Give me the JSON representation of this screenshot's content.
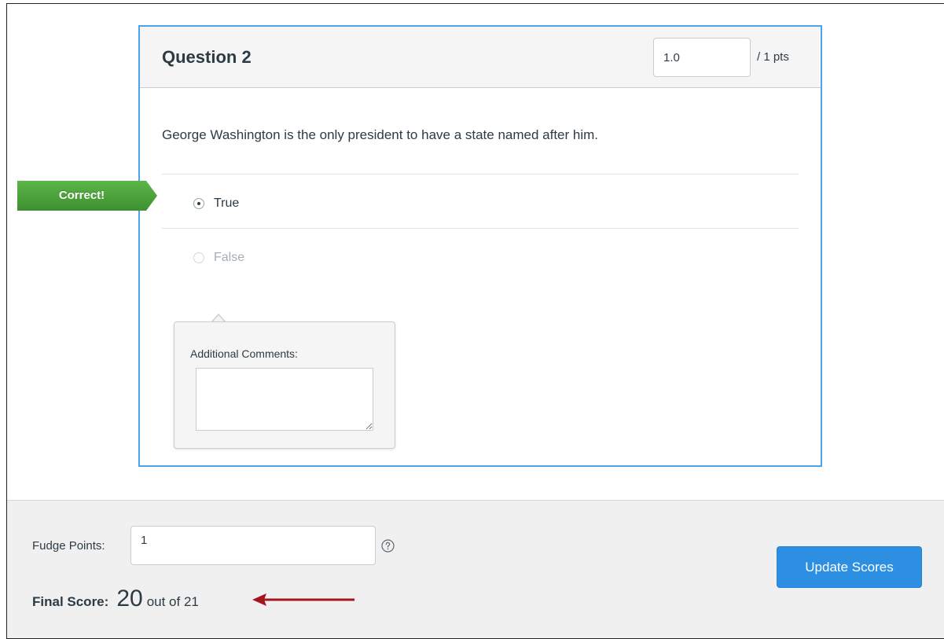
{
  "question": {
    "title": "Question 2",
    "points_value": "1.0",
    "points_suffix": "/ 1 pts",
    "text": "George Washington is the only president to have a state named after him.",
    "answers": [
      {
        "label": "True",
        "selected": true
      },
      {
        "label": "False",
        "selected": false
      }
    ],
    "feedback_flag": "Correct!",
    "comments_label": "Additional Comments:",
    "comments_value": ""
  },
  "footer": {
    "fudge_label": "Fudge Points:",
    "fudge_value": "1",
    "help_icon": "question-circle-icon",
    "final_score_label": "Final Score:",
    "final_score_value": "20",
    "final_score_outof": "out of 21",
    "update_button_label": "Update Scores"
  },
  "colors": {
    "card_border": "#49a4ef",
    "correct_flag": "#4aa13c",
    "primary_button": "#2d8fe2",
    "arrow": "#a4151c"
  }
}
